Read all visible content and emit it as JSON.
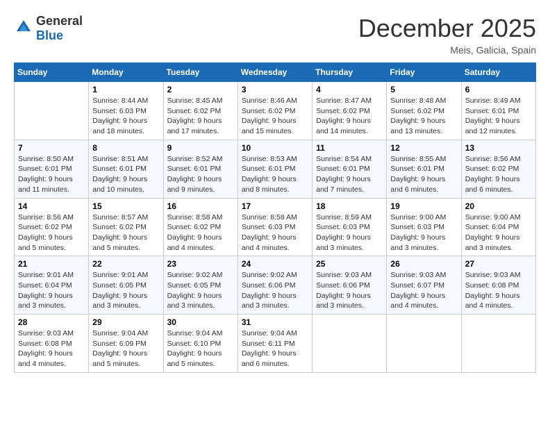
{
  "header": {
    "logo": {
      "text_general": "General",
      "text_blue": "Blue"
    },
    "title": "December 2025",
    "location": "Meis, Galicia, Spain"
  },
  "calendar": {
    "columns": [
      "Sunday",
      "Monday",
      "Tuesday",
      "Wednesday",
      "Thursday",
      "Friday",
      "Saturday"
    ],
    "weeks": [
      [
        {
          "day": "",
          "sunrise": "",
          "sunset": "",
          "daylight": ""
        },
        {
          "day": "1",
          "sunrise": "Sunrise: 8:44 AM",
          "sunset": "Sunset: 6:03 PM",
          "daylight": "Daylight: 9 hours and 18 minutes."
        },
        {
          "day": "2",
          "sunrise": "Sunrise: 8:45 AM",
          "sunset": "Sunset: 6:02 PM",
          "daylight": "Daylight: 9 hours and 17 minutes."
        },
        {
          "day": "3",
          "sunrise": "Sunrise: 8:46 AM",
          "sunset": "Sunset: 6:02 PM",
          "daylight": "Daylight: 9 hours and 15 minutes."
        },
        {
          "day": "4",
          "sunrise": "Sunrise: 8:47 AM",
          "sunset": "Sunset: 6:02 PM",
          "daylight": "Daylight: 9 hours and 14 minutes."
        },
        {
          "day": "5",
          "sunrise": "Sunrise: 8:48 AM",
          "sunset": "Sunset: 6:02 PM",
          "daylight": "Daylight: 9 hours and 13 minutes."
        },
        {
          "day": "6",
          "sunrise": "Sunrise: 8:49 AM",
          "sunset": "Sunset: 6:01 PM",
          "daylight": "Daylight: 9 hours and 12 minutes."
        }
      ],
      [
        {
          "day": "7",
          "sunrise": "Sunrise: 8:50 AM",
          "sunset": "Sunset: 6:01 PM",
          "daylight": "Daylight: 9 hours and 11 minutes."
        },
        {
          "day": "8",
          "sunrise": "Sunrise: 8:51 AM",
          "sunset": "Sunset: 6:01 PM",
          "daylight": "Daylight: 9 hours and 10 minutes."
        },
        {
          "day": "9",
          "sunrise": "Sunrise: 8:52 AM",
          "sunset": "Sunset: 6:01 PM",
          "daylight": "Daylight: 9 hours and 9 minutes."
        },
        {
          "day": "10",
          "sunrise": "Sunrise: 8:53 AM",
          "sunset": "Sunset: 6:01 PM",
          "daylight": "Daylight: 9 hours and 8 minutes."
        },
        {
          "day": "11",
          "sunrise": "Sunrise: 8:54 AM",
          "sunset": "Sunset: 6:01 PM",
          "daylight": "Daylight: 9 hours and 7 minutes."
        },
        {
          "day": "12",
          "sunrise": "Sunrise: 8:55 AM",
          "sunset": "Sunset: 6:01 PM",
          "daylight": "Daylight: 9 hours and 6 minutes."
        },
        {
          "day": "13",
          "sunrise": "Sunrise: 8:56 AM",
          "sunset": "Sunset: 6:02 PM",
          "daylight": "Daylight: 9 hours and 6 minutes."
        }
      ],
      [
        {
          "day": "14",
          "sunrise": "Sunrise: 8:56 AM",
          "sunset": "Sunset: 6:02 PM",
          "daylight": "Daylight: 9 hours and 5 minutes."
        },
        {
          "day": "15",
          "sunrise": "Sunrise: 8:57 AM",
          "sunset": "Sunset: 6:02 PM",
          "daylight": "Daylight: 9 hours and 5 minutes."
        },
        {
          "day": "16",
          "sunrise": "Sunrise: 8:58 AM",
          "sunset": "Sunset: 6:02 PM",
          "daylight": "Daylight: 9 hours and 4 minutes."
        },
        {
          "day": "17",
          "sunrise": "Sunrise: 8:58 AM",
          "sunset": "Sunset: 6:03 PM",
          "daylight": "Daylight: 9 hours and 4 minutes."
        },
        {
          "day": "18",
          "sunrise": "Sunrise: 8:59 AM",
          "sunset": "Sunset: 6:03 PM",
          "daylight": "Daylight: 9 hours and 3 minutes."
        },
        {
          "day": "19",
          "sunrise": "Sunrise: 9:00 AM",
          "sunset": "Sunset: 6:03 PM",
          "daylight": "Daylight: 9 hours and 3 minutes."
        },
        {
          "day": "20",
          "sunrise": "Sunrise: 9:00 AM",
          "sunset": "Sunset: 6:04 PM",
          "daylight": "Daylight: 9 hours and 3 minutes."
        }
      ],
      [
        {
          "day": "21",
          "sunrise": "Sunrise: 9:01 AM",
          "sunset": "Sunset: 6:04 PM",
          "daylight": "Daylight: 9 hours and 3 minutes."
        },
        {
          "day": "22",
          "sunrise": "Sunrise: 9:01 AM",
          "sunset": "Sunset: 6:05 PM",
          "daylight": "Daylight: 9 hours and 3 minutes."
        },
        {
          "day": "23",
          "sunrise": "Sunrise: 9:02 AM",
          "sunset": "Sunset: 6:05 PM",
          "daylight": "Daylight: 9 hours and 3 minutes."
        },
        {
          "day": "24",
          "sunrise": "Sunrise: 9:02 AM",
          "sunset": "Sunset: 6:06 PM",
          "daylight": "Daylight: 9 hours and 3 minutes."
        },
        {
          "day": "25",
          "sunrise": "Sunrise: 9:03 AM",
          "sunset": "Sunset: 6:06 PM",
          "daylight": "Daylight: 9 hours and 3 minutes."
        },
        {
          "day": "26",
          "sunrise": "Sunrise: 9:03 AM",
          "sunset": "Sunset: 6:07 PM",
          "daylight": "Daylight: 9 hours and 4 minutes."
        },
        {
          "day": "27",
          "sunrise": "Sunrise: 9:03 AM",
          "sunset": "Sunset: 6:08 PM",
          "daylight": "Daylight: 9 hours and 4 minutes."
        }
      ],
      [
        {
          "day": "28",
          "sunrise": "Sunrise: 9:03 AM",
          "sunset": "Sunset: 6:08 PM",
          "daylight": "Daylight: 9 hours and 4 minutes."
        },
        {
          "day": "29",
          "sunrise": "Sunrise: 9:04 AM",
          "sunset": "Sunset: 6:09 PM",
          "daylight": "Daylight: 9 hours and 5 minutes."
        },
        {
          "day": "30",
          "sunrise": "Sunrise: 9:04 AM",
          "sunset": "Sunset: 6:10 PM",
          "daylight": "Daylight: 9 hours and 5 minutes."
        },
        {
          "day": "31",
          "sunrise": "Sunrise: 9:04 AM",
          "sunset": "Sunset: 6:11 PM",
          "daylight": "Daylight: 9 hours and 6 minutes."
        },
        {
          "day": "",
          "sunrise": "",
          "sunset": "",
          "daylight": ""
        },
        {
          "day": "",
          "sunrise": "",
          "sunset": "",
          "daylight": ""
        },
        {
          "day": "",
          "sunrise": "",
          "sunset": "",
          "daylight": ""
        }
      ]
    ]
  }
}
